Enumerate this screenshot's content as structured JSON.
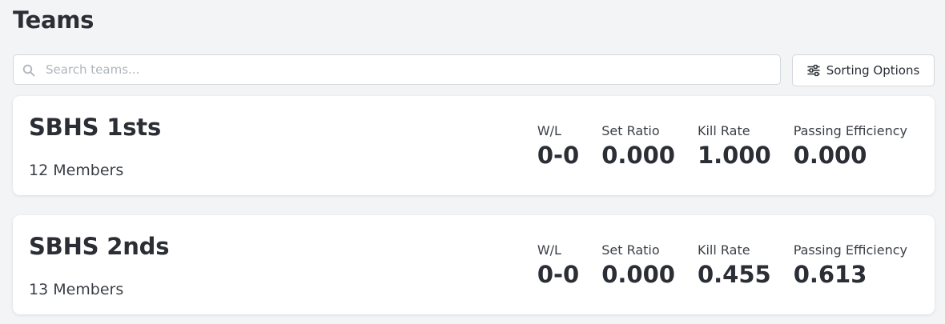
{
  "page": {
    "title": "Teams"
  },
  "search": {
    "placeholder": "Search teams..."
  },
  "toolbar": {
    "sort_label": "Sorting Options"
  },
  "teams": [
    {
      "name": "SBHS 1sts",
      "members": "12 Members",
      "stats": {
        "wl_label": "W/L",
        "wl_value": "0-0",
        "set_ratio_label": "Set Ratio",
        "set_ratio_value": "0.000",
        "kill_rate_label": "Kill Rate",
        "kill_rate_value": "1.000",
        "passing_label": "Passing Efficiency",
        "passing_value": "0.000"
      }
    },
    {
      "name": "SBHS 2nds",
      "members": "13 Members",
      "stats": {
        "wl_label": "W/L",
        "wl_value": "0-0",
        "set_ratio_label": "Set Ratio",
        "set_ratio_value": "0.000",
        "kill_rate_label": "Kill Rate",
        "kill_rate_value": "0.455",
        "passing_label": "Passing Efficiency",
        "passing_value": "0.613"
      }
    }
  ],
  "icons": {
    "search": "search-icon",
    "sort": "sliders-icon"
  },
  "colors": {
    "background": "#f3f4f6",
    "card": "#ffffff",
    "text": "#2b2f35",
    "placeholder": "#b0b5bc",
    "border": "#d4d7dc"
  }
}
